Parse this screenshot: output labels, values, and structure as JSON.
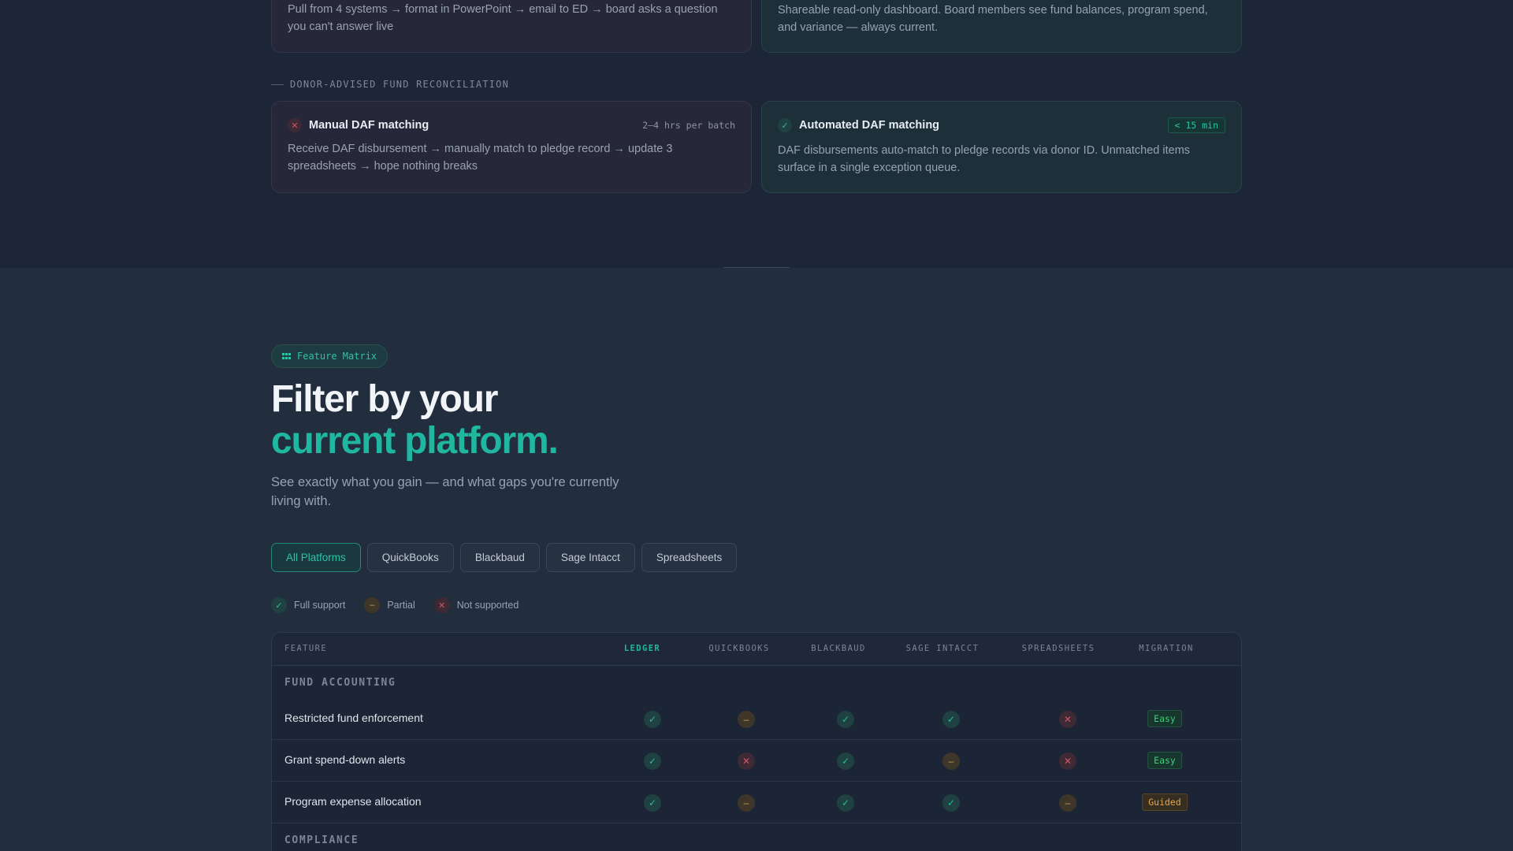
{
  "top_cards": [
    {
      "kind": "bad",
      "desc": "Pull from 4 systems → format in PowerPoint → email to ED → board asks a question you can't answer live"
    },
    {
      "kind": "good",
      "desc": "Shareable read-only dashboard. Board members see fund balances, program spend, and variance — always current."
    }
  ],
  "daf_section": {
    "label": "DONOR-ADVISED FUND RECONCILIATION",
    "manual": {
      "status_icon": "x-icon",
      "title": "Manual DAF matching",
      "meta": "2–4 hrs per batch",
      "desc": "Receive DAF disbursement → manually match to pledge record → update 3 spreadsheets → hope nothing breaks"
    },
    "automated": {
      "status_icon": "check-icon",
      "title": "Automated DAF matching",
      "pill": "< 15 min",
      "desc": "DAF disbursements auto-match to pledge records via donor ID. Unmatched items surface in a single exception queue."
    }
  },
  "feature_matrix": {
    "badge": "Feature Matrix",
    "badge_icon": "grid-icon",
    "heading_line1": "Filter by your",
    "heading_line2": "current platform.",
    "subtitle": "See exactly what you gain — and what gaps you're currently living with.",
    "filters": [
      "All Platforms",
      "QuickBooks",
      "Blackbaud",
      "Sage Intacct",
      "Spreadsheets"
    ],
    "active_filter": "All Platforms",
    "legend": [
      {
        "status": "full",
        "label": "Full support"
      },
      {
        "status": "partial",
        "label": "Partial"
      },
      {
        "status": "none",
        "label": "Not supported"
      }
    ]
  },
  "table": {
    "columns": [
      "FEATURE",
      "LEDGER",
      "QUICKBOOKS",
      "BLACKBAUD",
      "SAGE INTACCT",
      "SPREADSHEETS",
      "MIGRATION"
    ],
    "groups": [
      {
        "name": "FUND ACCOUNTING",
        "rows": [
          {
            "feature": "Restricted fund enforcement",
            "support": [
              "full",
              "partial",
              "full",
              "full",
              "none"
            ],
            "migration": "Easy"
          },
          {
            "feature": "Grant spend-down alerts",
            "support": [
              "full",
              "none",
              "full",
              "partial",
              "none"
            ],
            "migration": "Easy"
          },
          {
            "feature": "Program expense allocation",
            "support": [
              "full",
              "partial",
              "full",
              "full",
              "partial"
            ],
            "migration": "Guided"
          }
        ]
      },
      {
        "name": "COMPLIANCE",
        "rows": []
      }
    ]
  },
  "colors": {
    "accent": "#20b7a0",
    "full": "#2cb89f",
    "partial": "#c9a25a",
    "none": "#d1546a",
    "easy": "#3fcf7a",
    "guided": "#e2a847"
  }
}
